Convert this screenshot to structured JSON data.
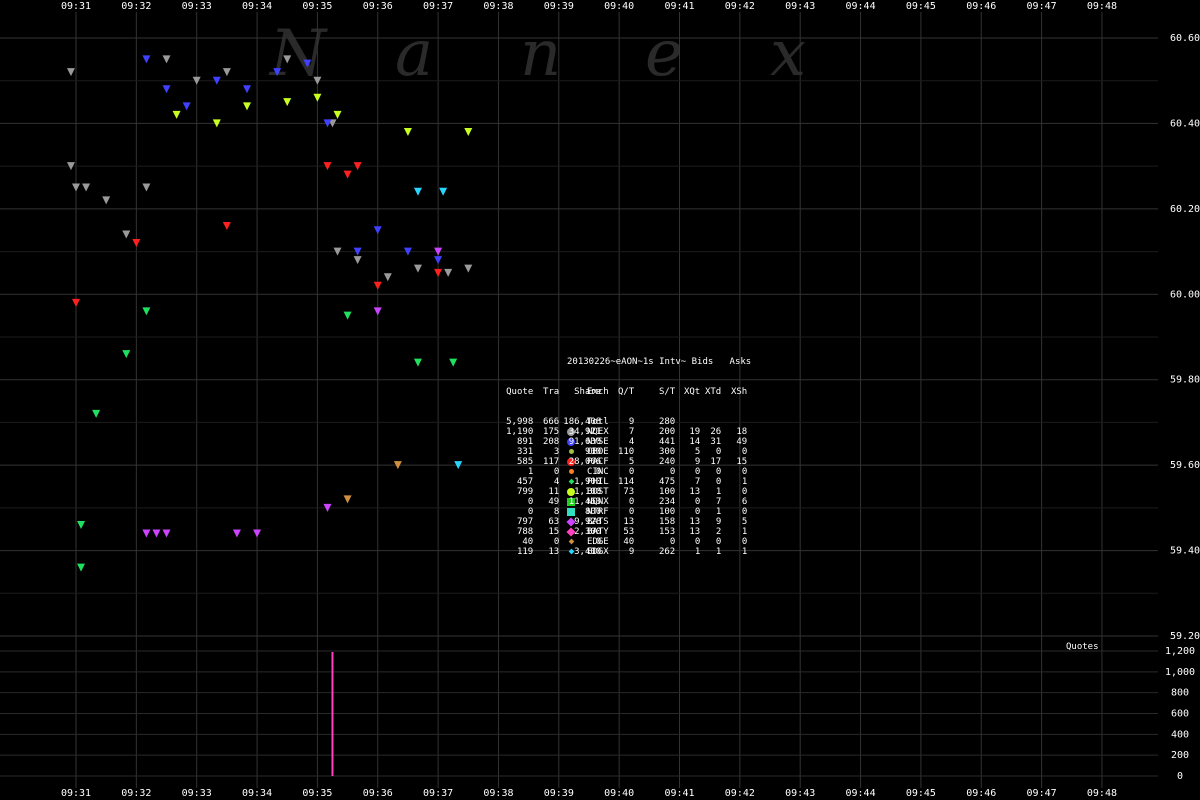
{
  "chart_data": [
    {
      "type": "scatter",
      "title": "",
      "watermark": "Nanex",
      "x_ticks": [
        "09:31",
        "09:32",
        "09:33",
        "09:34",
        "09:35",
        "09:36",
        "09:37",
        "09:38",
        "09:39",
        "09:40",
        "09:41",
        "09:42",
        "09:43",
        "09:44",
        "09:45",
        "09:46",
        "09:47",
        "09:48"
      ],
      "y_ticks": [
        "60.60",
        "60.40",
        "60.20",
        "60.00",
        "59.80",
        "59.60",
        "59.40",
        "59.20"
      ],
      "ylim": [
        59.2,
        60.6
      ],
      "grid": true,
      "series": [
        {
          "name": "NQEX",
          "color": "#9a9a9a",
          "points": [
            [
              "09:30:55",
              60.52
            ],
            [
              "09:30:55",
              60.3
            ],
            [
              "09:31:00",
              60.25
            ],
            [
              "09:31:10",
              60.25
            ],
            [
              "09:31:30",
              60.22
            ],
            [
              "09:31:50",
              60.14
            ],
            [
              "09:32:10",
              60.25
            ],
            [
              "09:32:30",
              60.55
            ],
            [
              "09:33:00",
              60.5
            ],
            [
              "09:33:30",
              60.52
            ],
            [
              "09:34:30",
              60.55
            ],
            [
              "09:35:00",
              60.5
            ],
            [
              "09:35:15",
              60.4
            ],
            [
              "09:35:20",
              60.1
            ],
            [
              "09:35:40",
              60.08
            ],
            [
              "09:36:10",
              60.04
            ],
            [
              "09:36:40",
              60.06
            ],
            [
              "09:37:10",
              60.05
            ],
            [
              "09:37:30",
              60.06
            ]
          ]
        },
        {
          "name": "NYSE",
          "color": "#4040ff",
          "points": [
            [
              "09:32:10",
              60.55
            ],
            [
              "09:32:30",
              60.48
            ],
            [
              "09:32:50",
              60.44
            ],
            [
              "09:33:20",
              60.5
            ],
            [
              "09:33:50",
              60.48
            ],
            [
              "09:34:20",
              60.52
            ],
            [
              "09:34:50",
              60.54
            ],
            [
              "09:35:10",
              60.4
            ],
            [
              "09:35:40",
              60.1
            ],
            [
              "09:36:00",
              60.15
            ],
            [
              "09:36:30",
              60.1
            ],
            [
              "09:37:00",
              60.08
            ]
          ]
        },
        {
          "name": "PACF",
          "color": "#ff2020",
          "points": [
            [
              "09:31:00",
              59.98
            ],
            [
              "09:32:00",
              60.12
            ],
            [
              "09:33:30",
              60.16
            ],
            [
              "09:35:10",
              60.3
            ],
            [
              "09:35:30",
              60.28
            ],
            [
              "09:35:40",
              60.3
            ],
            [
              "09:36:00",
              60.02
            ],
            [
              "09:37:00",
              60.05
            ]
          ]
        },
        {
          "name": "BOST",
          "color": "#c8ff20",
          "points": [
            [
              "09:32:40",
              60.42
            ],
            [
              "09:33:20",
              60.4
            ],
            [
              "09:33:50",
              60.44
            ],
            [
              "09:34:30",
              60.45
            ],
            [
              "09:35:00",
              60.46
            ],
            [
              "09:35:20",
              60.42
            ],
            [
              "09:36:30",
              60.38
            ],
            [
              "09:37:30",
              60.38
            ]
          ]
        },
        {
          "name": "BATS",
          "color": "#cc44ff",
          "points": [
            [
              "09:32:10",
              59.44
            ],
            [
              "09:32:20",
              59.44
            ],
            [
              "09:32:30",
              59.44
            ],
            [
              "09:33:40",
              59.44
            ],
            [
              "09:34:00",
              59.44
            ],
            [
              "09:35:10",
              59.5
            ],
            [
              "09:36:00",
              59.96
            ],
            [
              "09:37:00",
              60.1
            ]
          ]
        },
        {
          "name": "PHIL",
          "color": "#20e060",
          "points": [
            [
              "09:31:05",
              59.46
            ],
            [
              "09:31:05",
              59.36
            ],
            [
              "09:31:20",
              59.72
            ],
            [
              "09:31:50",
              59.86
            ],
            [
              "09:32:10",
              59.96
            ],
            [
              "09:35:30",
              59.95
            ],
            [
              "09:36:40",
              59.84
            ],
            [
              "09:37:15",
              59.84
            ]
          ]
        },
        {
          "name": "EDGX",
          "color": "#2ad4ff",
          "points": [
            [
              "09:36:40",
              60.24
            ],
            [
              "09:37:05",
              60.24
            ],
            [
              "09:37:20",
              59.6
            ]
          ]
        },
        {
          "name": "EDGE",
          "color": "#d09040",
          "points": [
            [
              "09:35:30",
              59.52
            ],
            [
              "09:36:20",
              59.6
            ]
          ]
        }
      ]
    },
    {
      "type": "bar",
      "title": "",
      "label": "Quotes",
      "y_ticks": [
        "1,200",
        "1,000",
        "800",
        "600",
        "400",
        "200",
        "0"
      ],
      "ylim": [
        0,
        1200
      ],
      "peak_time": "09:35:15",
      "peak_value": 1190
    }
  ],
  "stats_table": {
    "header": "20130226~eAON~1s Intv~ Bids   Asks",
    "columns": [
      "Exch",
      "Quote",
      "Tra",
      "Share",
      "Q/T",
      "S/T",
      "XQt",
      "XTd",
      "XSh"
    ],
    "rows": [
      {
        "exch": "Totl",
        "quote": "5,998",
        "tra": "666",
        "share": "186,408",
        "qt": "9",
        "st": "280",
        "xqt": "",
        "xtd": "",
        "xsh": "",
        "color": "",
        "shape": "none"
      },
      {
        "exch": "NQEX",
        "quote": "1,190",
        "tra": "175",
        "share": "34,921",
        "qt": "7",
        "st": "200",
        "xqt": "19",
        "xtd": "26",
        "xsh": "18",
        "color": "#9a9a9a",
        "shape": "circle"
      },
      {
        "exch": "NYSE",
        "quote": "891",
        "tra": "208",
        "share": "91,630",
        "qt": "4",
        "st": "441",
        "xqt": "14",
        "xtd": "31",
        "xsh": "49",
        "color": "#4040ff",
        "shape": "circle"
      },
      {
        "exch": "CBOE",
        "quote": "331",
        "tra": "3",
        "share": "900",
        "qt": "110",
        "st": "300",
        "xqt": "5",
        "xtd": "0",
        "xsh": "0",
        "color": "#a0c040",
        "shape": "small-circle"
      },
      {
        "exch": "PACF",
        "quote": "585",
        "tra": "117",
        "share": "28,066",
        "qt": "5",
        "st": "240",
        "xqt": "9",
        "xtd": "17",
        "xsh": "15",
        "color": "#ff2020",
        "shape": "circle"
      },
      {
        "exch": "CINC",
        "quote": "1",
        "tra": "0",
        "share": "0",
        "qt": "0",
        "st": "0",
        "xqt": "0",
        "xtd": "0",
        "xsh": "0",
        "color": "#ff8020",
        "shape": "small-circle"
      },
      {
        "exch": "PHIL",
        "quote": "457",
        "tra": "4",
        "share": "1,900",
        "qt": "114",
        "st": "475",
        "xqt": "7",
        "xtd": "0",
        "xsh": "1",
        "color": "#20e060",
        "shape": "small-diamond"
      },
      {
        "exch": "BOST",
        "quote": "799",
        "tra": "11",
        "share": "1,100",
        "qt": "73",
        "st": "100",
        "xqt": "13",
        "xtd": "1",
        "xsh": "0",
        "color": "#c8ff20",
        "shape": "circle"
      },
      {
        "exch": "NQNX",
        "quote": "0",
        "tra": "49",
        "share": "11,463",
        "qt": "0",
        "st": "234",
        "xqt": "0",
        "xtd": "7",
        "xsh": "6",
        "color": "#20d020",
        "shape": "square"
      },
      {
        "exch": "NTRF",
        "quote": "0",
        "tra": "8",
        "share": "800",
        "qt": "0",
        "st": "100",
        "xqt": "0",
        "xtd": "1",
        "xsh": "0",
        "color": "#30e0c0",
        "shape": "square"
      },
      {
        "exch": "BATS",
        "quote": "797",
        "tra": "63",
        "share": "9,928",
        "qt": "13",
        "st": "158",
        "xqt": "13",
        "xtd": "9",
        "xsh": "5",
        "color": "#cc44ff",
        "shape": "diamond"
      },
      {
        "exch": "BATY",
        "quote": "788",
        "tra": "15",
        "share": "2,300",
        "qt": "53",
        "st": "153",
        "xqt": "13",
        "xtd": "2",
        "xsh": "1",
        "color": "#ff40c0",
        "shape": "diamond"
      },
      {
        "exch": "EDGE",
        "quote": "40",
        "tra": "0",
        "share": "0",
        "qt": "40",
        "st": "0",
        "xqt": "0",
        "xtd": "0",
        "xsh": "0",
        "color": "#d09040",
        "shape": "small-diamond"
      },
      {
        "exch": "EDGX",
        "quote": "119",
        "tra": "13",
        "share": "3,400",
        "qt": "9",
        "st": "262",
        "xqt": "1",
        "xtd": "1",
        "xsh": "1",
        "color": "#2ad4ff",
        "shape": "small-diamond"
      }
    ]
  }
}
